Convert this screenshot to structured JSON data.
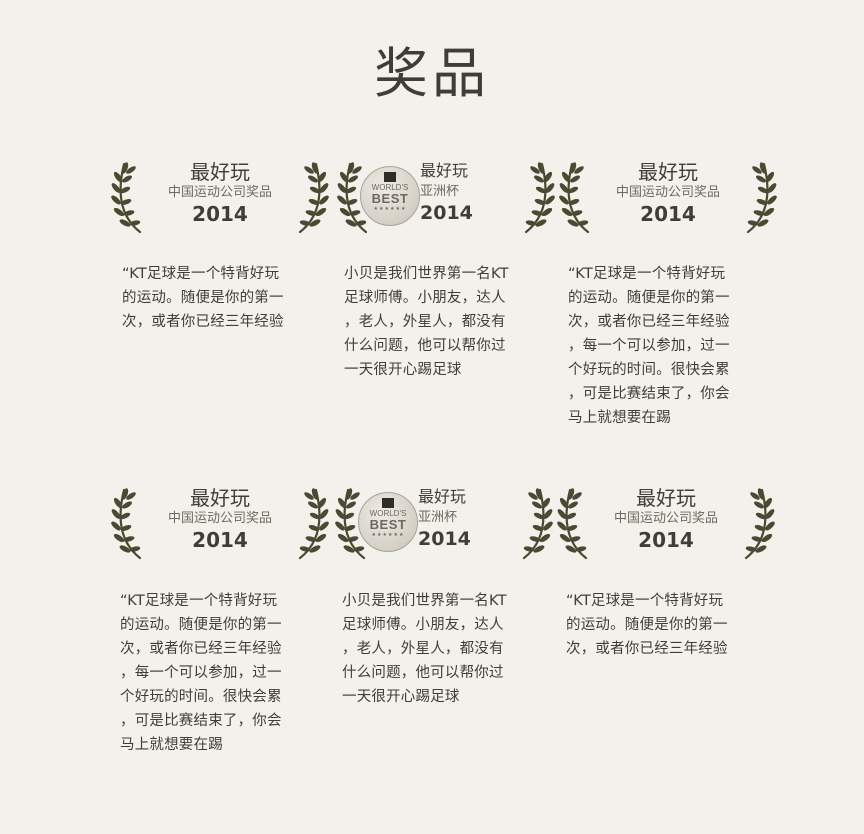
{
  "page": {
    "title": "奖品"
  },
  "cards": [
    {
      "award": {
        "kind": "plain",
        "title": "最好玩",
        "subtitle": "中国运动公司奖品",
        "year": "2014"
      },
      "lines": [
        "“KT足球是一个特背好玩",
        "的运动。随便是你的第一",
        "次，或者你已经三年经验"
      ]
    },
    {
      "award": {
        "kind": "medal",
        "title": "最好玩",
        "subtitle": "亚洲杯",
        "year": "2014",
        "medal": {
          "line1": "WORLD'S",
          "line2": "BEST",
          "stars": "★★★★★★"
        }
      },
      "lines": [
        "小贝是我们世界第一名KT",
        "足球师傅。小朋友，达人",
        "，老人，外星人，都没有",
        "什么问题，他可以帮你过",
        "一天很开心踢足球"
      ]
    },
    {
      "award": {
        "kind": "plain",
        "title": "最好玩",
        "subtitle": "中国运动公司奖品",
        "year": "2014"
      },
      "lines": [
        "“KT足球是一个特背好玩",
        "的运动。随便是你的第一",
        "次，或者你已经三年经验",
        "，每一个可以参加，过一",
        "个好玩的时间。很快会累",
        "，可是比赛结束了，你会",
        "马上就想要在踢"
      ]
    },
    {
      "award": {
        "kind": "plain",
        "title": "最好玩",
        "subtitle": "中国运动公司奖品",
        "year": "2014"
      },
      "lines": [
        "“KT足球是一个特背好玩",
        "的运动。随便是你的第一",
        "次，或者你已经三年经验",
        "，每一个可以参加，过一",
        "个好玩的时间。很快会累",
        "，可是比赛结束了，你会",
        "马上就想要在踢"
      ]
    },
    {
      "award": {
        "kind": "medal",
        "title": "最好玩",
        "subtitle": "亚洲杯",
        "year": "2014",
        "medal": {
          "line1": "WORLD'S",
          "line2": "BEST",
          "stars": "★★★★★★"
        }
      },
      "lines": [
        "小贝是我们世界第一名KT",
        "足球师傅。小朋友，达人",
        "，老人，外星人，都没有",
        "什么问题，他可以帮你过",
        "一天很开心踢足球"
      ]
    },
    {
      "award": {
        "kind": "plain",
        "title": "最好玩",
        "subtitle": "中国运动公司奖品",
        "year": "2014"
      },
      "lines": [
        "“KT足球是一个特背好玩",
        "的运动。随便是你的第一",
        "次，或者你已经三年经验"
      ]
    }
  ],
  "colors": {
    "background": "#f3f1ec",
    "text": "#3f3e36",
    "laurel": "#4a4a33"
  },
  "icons": {
    "laurel": "laurel-wreath-icon",
    "medal": "worlds-best-medal-icon"
  }
}
